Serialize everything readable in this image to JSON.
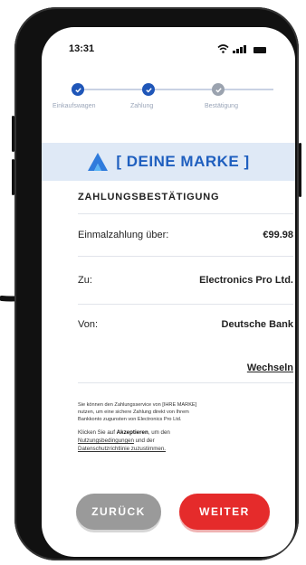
{
  "status_bar": {
    "time": "13:31"
  },
  "stepper": {
    "steps": [
      {
        "label": "Einkaufswagen",
        "state": "done"
      },
      {
        "label": "Zahlung",
        "state": "active"
      },
      {
        "label": "Bestätigung",
        "state": "pending"
      }
    ]
  },
  "brand": {
    "text": "[ DEINE MARKE ]"
  },
  "confirmation": {
    "title": "ZAHLUNGSBESTÄTIGUNG",
    "amount_label": "Einmalzahlung über:",
    "amount_value": "€99.98",
    "to_label": "Zu:",
    "to_value": "Electronics Pro Ltd.",
    "from_label": "Von:",
    "from_value": "Deutsche Bank",
    "change_link": "Wechseln"
  },
  "fine_print": {
    "line1": "Sie können den Zahlungsservice von [IHRE MARKE]",
    "line2": "nutzen, um eine sichere Zahlung direkt von Ihrem",
    "line3": "Bankkonto zugunsten von Electronics Pro Ltd.",
    "accept_prefix": "Klicken Sie auf",
    "accept_bold": "Akzeptieren",
    "accept_mid": ", um den",
    "terms_link": "Nutzungsbedingungen",
    "and": "und der",
    "privacy_link": "Datenschutzrichtlinie zuzustimmen."
  },
  "buttons": {
    "back": "ZURÜCK",
    "next": "WEITER"
  },
  "colors": {
    "brand_blue": "#1f5fbf",
    "accent_red": "#e52b2b",
    "back_gray": "#9a9a9a"
  },
  "icons": [
    "wifi-icon",
    "signal-icon",
    "battery-icon",
    "check-icon",
    "brand-logo-icon",
    "pointer-arrow-icon"
  ]
}
